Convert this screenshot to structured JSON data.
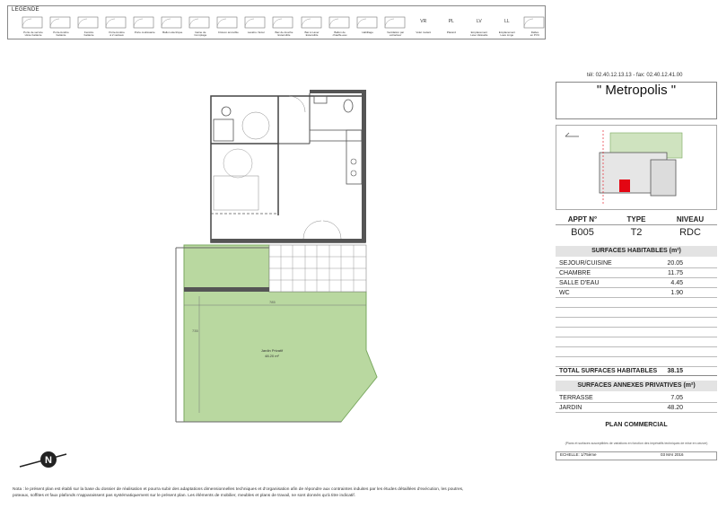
{
  "legend": {
    "title": "LEGENDE",
    "items": [
      {
        "label": "Porte de service\nvitrée battante",
        "icon": "door-swing-icon"
      },
      {
        "label": "Porte-fenêtre\nbattante",
        "icon": "door-swing-icon"
      },
      {
        "label": "Fenêtre\nbattante",
        "icon": "double-door-icon"
      },
      {
        "label": "Porte-fenêtre\nà 2 vantaux",
        "icon": "double-door-icon"
      },
      {
        "label": "Porte coulissante",
        "icon": "sliding-door-icon"
      },
      {
        "label": "Ballon électrique",
        "icon": "water-heater-icon"
      },
      {
        "label": "Gaine de\nComptage",
        "icon": "duct-icon"
      },
      {
        "label": "Cloison amovible",
        "icon": "partition-icon"
      },
      {
        "label": "Lavabo / Evier",
        "icon": "sink-icon"
      },
      {
        "label": "Bac de douche\nExtensible",
        "icon": "shower-icon"
      },
      {
        "label": "Bac à Laver\nExtensible",
        "icon": "washtub-icon"
      },
      {
        "label": "Ballon de\nchauffe-eau",
        "icon": "boiler-icon"
      },
      {
        "label": "Habillage",
        "icon": "cladding-icon"
      },
      {
        "label": "Ventilation par\nextracteur",
        "icon": "fan-icon"
      },
      {
        "code": "VR",
        "label": "Volet roulant"
      },
      {
        "code": "PL",
        "label": "Placard"
      },
      {
        "code": "LV",
        "label": "Emplacement\nLave Vaisselle"
      },
      {
        "code": "LL",
        "label": "Emplacement\nLave Linge"
      },
      {
        "label": "Dalles\nen PVC",
        "icon": "tiles-icon"
      }
    ]
  },
  "contact": "tél: 02.40.12.13.13 - fax: 02.40.12.41.00",
  "project_title": "\" Metropolis \"",
  "apartment": {
    "headers": [
      "APPT N°",
      "TYPE",
      "NIVEAU"
    ],
    "values": [
      "B005",
      "T2",
      "RDC"
    ]
  },
  "surfaces_habitables": {
    "title": "SURFACES HABITABLES (m²)",
    "rows": [
      {
        "name": "SEJOUR/CUISINE",
        "value": "20.05"
      },
      {
        "name": "CHAMBRE",
        "value": "11.75"
      },
      {
        "name": "SALLE D'EAU",
        "value": "4.45"
      },
      {
        "name": "WC",
        "value": "1.90"
      }
    ],
    "total_label": "TOTAL SURFACES HABITABLES",
    "total_value": "38.15"
  },
  "surfaces_annexes": {
    "title": "SURFACES ANNEXES PRIVATIVES (m²)",
    "rows": [
      {
        "name": "TERRASSE",
        "value": "7.05"
      },
      {
        "name": "JARDIN",
        "value": "48.20"
      }
    ]
  },
  "plan_label": "PLAN COMMERCIAL",
  "small_note": "(Plans et surfaces susceptibles de variations en fonction des impératifs techniques de mise en oeuvre)",
  "scale": {
    "left": "ECHELLE: 1/75ème",
    "right": "03 MAI 2016"
  },
  "garden_label": {
    "name": "Jardin Privatif",
    "area": "48.20 m²"
  },
  "dimensions": {
    "horizontal": "785",
    "vertical": "735"
  },
  "compass_letter": "N",
  "footnote": "Nota : le présent plan est établi sur la base du dossier de réalisation et pourra subir des adaptations dimensionnelles techniques et d'organisation afin de répondre aux contraintes induites par les études détaillées d'exécution, les poutres, poteaux, soffites et faux plafonds n'apparaissent pas systématiquement sur le présent plan. Les éléments de mobilier, meubles et plans de travail, ne sont donnés qu'à titre indicatif.",
  "colors": {
    "garden": "#b9d8a0",
    "garden_border": "#7aa860",
    "walls": "#444444",
    "highlight": "#e30613",
    "header_bg": "#e3e3e3"
  }
}
